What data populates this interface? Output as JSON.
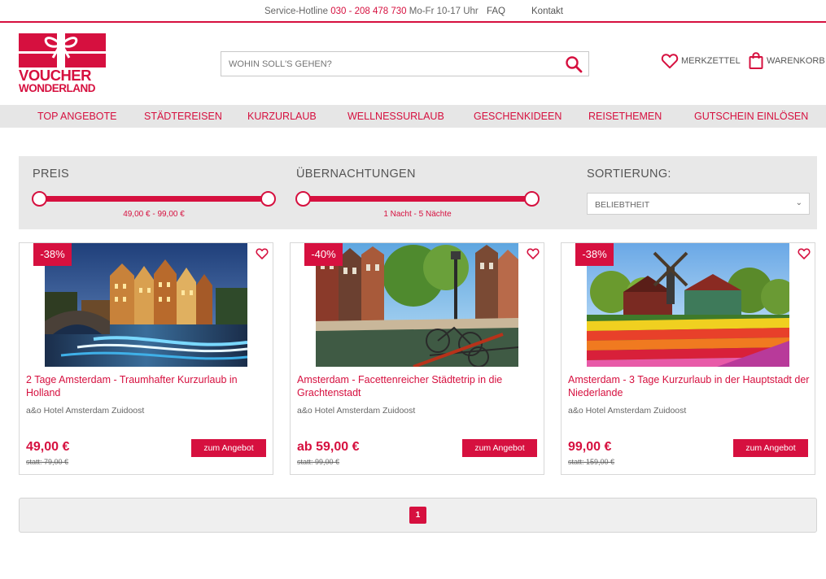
{
  "topbar": {
    "hotline_label": "Service-Hotline",
    "hotline_number": "030 - 208 478 730",
    "hotline_hours": "Mo-Fr 10-17 Uhr",
    "faq": "FAQ",
    "kontakt": "Kontakt"
  },
  "brand": {
    "line1": "VOUCHER",
    "line2": "WONDERLAND",
    "accent_color": "#d6103f"
  },
  "search": {
    "placeholder": "WOHIN SOLL'S GEHEN?",
    "icon": "search-icon"
  },
  "header": {
    "merkzettel": "MERKZETTEL",
    "warenkorb": "WARENKORB"
  },
  "nav": {
    "items": [
      "TOP ANGEBOTE",
      "STÄDTEREISEN",
      "KURZURLAUB",
      "WELLNESSURLAUB",
      "GESCHENKIDEEN",
      "REISETHEMEN",
      "GUTSCHEIN EINLÖSEN"
    ]
  },
  "filter": {
    "price_label": "PREIS",
    "price_range": "49,00 € - 99,00 €",
    "nights_label": "ÜBERNACHTUNGEN",
    "nights_range": "1 Nacht - 5 Nächte",
    "sort_label": "SORTIERUNG:",
    "sort_value": "BELIEBTHEIT"
  },
  "offers": [
    {
      "discount": "-38%",
      "title": "2 Tage Amsterdam - Traumhafter Kurzurlaub in Holland",
      "hotel": "a&o Hotel Amsterdam Zuidoost",
      "price": "49,00 €",
      "old_price": "statt: 79,00 €",
      "button": "zum Angebot"
    },
    {
      "discount": "-40%",
      "title": "Amsterdam - Facettenreicher Städtetrip in die Grachtenstadt",
      "hotel": "a&o Hotel Amsterdam Zuidoost",
      "price": "ab 59,00 €",
      "old_price": "statt: 99,00 €",
      "button": "zum Angebot"
    },
    {
      "discount": "-38%",
      "title": "Amsterdam - 3 Tage Kurzurlaub in der Hauptstadt der Niederlande",
      "hotel": "a&o Hotel Amsterdam Zuidoost",
      "price": "99,00 €",
      "old_price": "statt: 159,00 €",
      "button": "zum Angebot"
    }
  ],
  "pagination": {
    "current": "1"
  }
}
